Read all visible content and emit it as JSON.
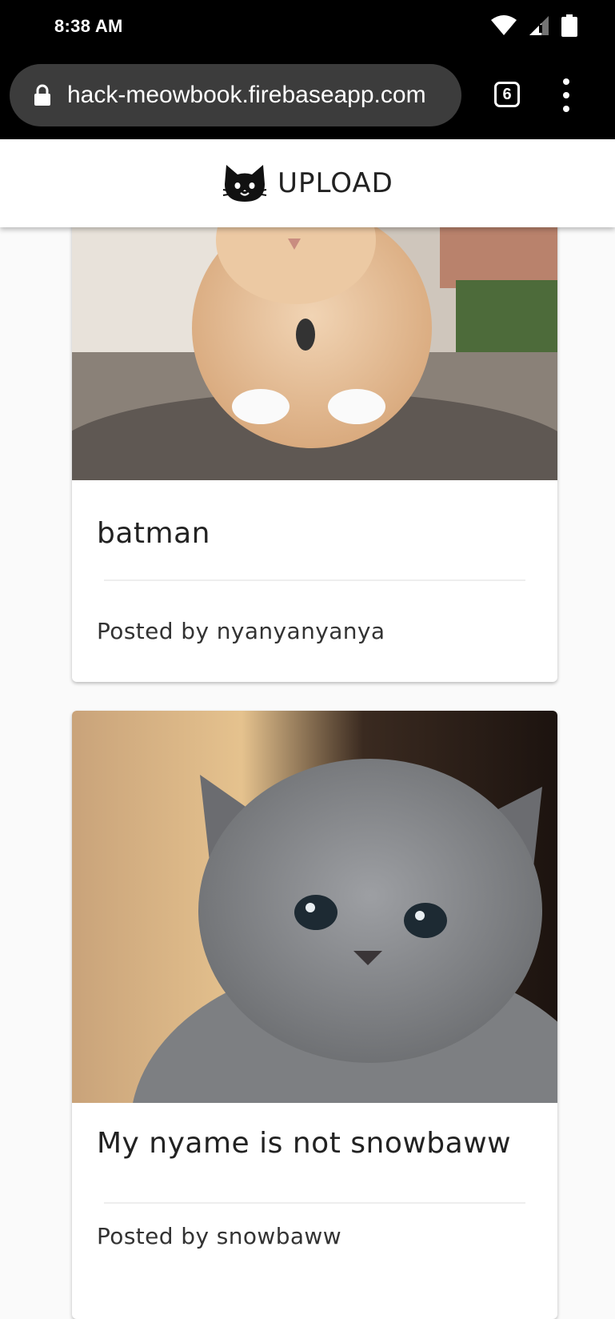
{
  "status_bar": {
    "time": "8:38 AM",
    "icons": [
      "wifi-icon",
      "signal-icon",
      "battery-icon"
    ]
  },
  "browser": {
    "url": "hack-meowbook.firebaseapp.com",
    "tab_count": "6"
  },
  "header": {
    "upload_label": "UPLOAD",
    "logo_icon": "cat-face-icon"
  },
  "posts": [
    {
      "title": "batman",
      "author": "Posted by nyanyanyanya"
    },
    {
      "title": "My nyame is not snowbaww",
      "author": "Posted by snowbaww"
    }
  ],
  "colors": {
    "status_bar": "#000000",
    "omnibox": "#3c3c3c",
    "header_bg": "#ffffff",
    "page_bg": "#fafafa"
  }
}
